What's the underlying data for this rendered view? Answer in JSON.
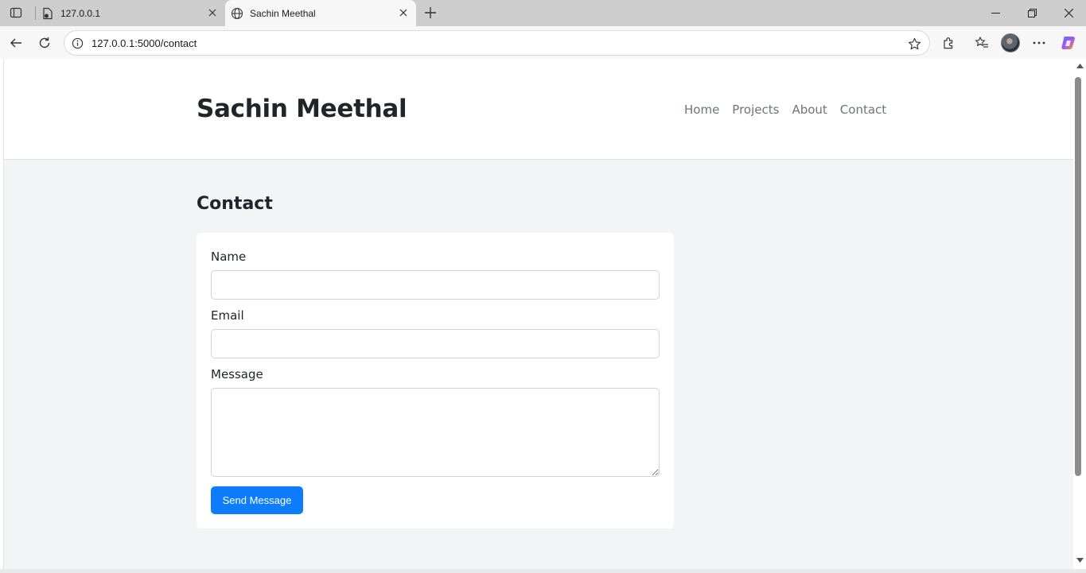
{
  "browser": {
    "tabs": [
      {
        "title": "127.0.0.1",
        "icon": "document-icon",
        "active": false
      },
      {
        "title": "Sachin Meethal",
        "icon": "globe-icon",
        "active": true
      }
    ],
    "address": {
      "url": "127.0.0.1:5000/contact"
    },
    "toolbar_icons": [
      "back-icon",
      "refresh-icon",
      "info-icon",
      "star-icon",
      "extensions-icon",
      "favorites-icon",
      "avatar",
      "more-icon",
      "copilot-icon"
    ],
    "window_controls": [
      "minimize-icon",
      "restore-icon",
      "close-icon"
    ]
  },
  "site": {
    "title": "Sachin Meethal",
    "nav": {
      "home": "Home",
      "projects": "Projects",
      "about": "About",
      "contact": "Contact"
    }
  },
  "contact": {
    "heading": "Contact",
    "form": {
      "name_label": "Name",
      "name_value": "",
      "email_label": "Email",
      "email_value": "",
      "message_label": "Message",
      "message_value": "",
      "submit_label": "Send Message"
    }
  },
  "colors": {
    "page_bg": "#f3f4f6",
    "header_bg": "#ffffff",
    "accent": "#0d7dfd",
    "nav_text": "#6c757d",
    "heading_text": "#212529"
  }
}
